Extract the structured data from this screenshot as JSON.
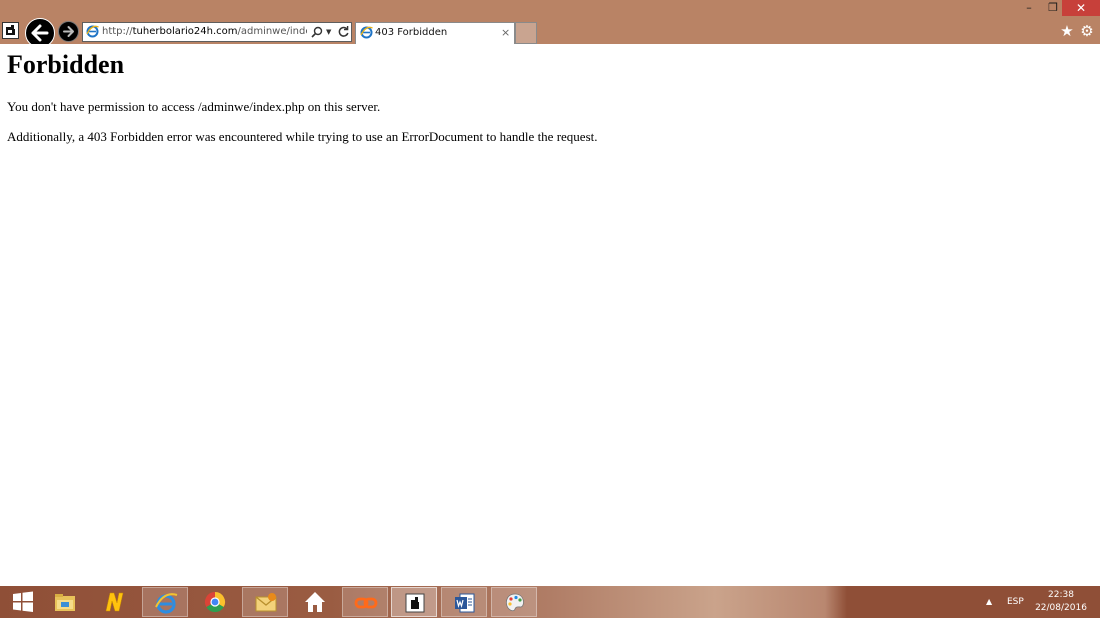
{
  "browser": {
    "address": {
      "prefix": "http://",
      "domain": "tuherbolario24h.com",
      "path": "/adminwe/index.php"
    },
    "tab": {
      "title": "403 Forbidden",
      "close_glyph": "×"
    },
    "window_controls": {
      "minimize": "–",
      "restore": "❐",
      "close": "✕"
    },
    "toolbar_icons": [
      "page-icon",
      "back-arrow-icon",
      "forward-arrow-icon",
      "search-icon",
      "refresh-icon",
      "favorites-star-icon",
      "gear-icon"
    ],
    "favorites_glyph": "★",
    "tools_glyph": "⚙",
    "dropdown_glyph": "▼"
  },
  "page": {
    "heading": "Forbidden",
    "paragraph_1": "You don't have permission to access /adminwe/index.php on this server.",
    "paragraph_2": "Additionally, a 403 Forbidden error was encountered while trying to use an ErrorDocument to handle the request."
  },
  "taskbar": {
    "items": [
      "windows-start",
      "file-explorer",
      "norton",
      "internet-explorer",
      "chrome",
      "outlook",
      "home",
      "link-app",
      "browser-app",
      "word",
      "paint"
    ],
    "tray": {
      "chevron": "▲",
      "language": "ESP",
      "time": "22:38",
      "date": "22/08/2016"
    }
  },
  "colors": {
    "chrome_background": "#b98365",
    "close_button": "#c7403a",
    "taskbar": "#8f4f37",
    "page_background": "#ffffff"
  }
}
